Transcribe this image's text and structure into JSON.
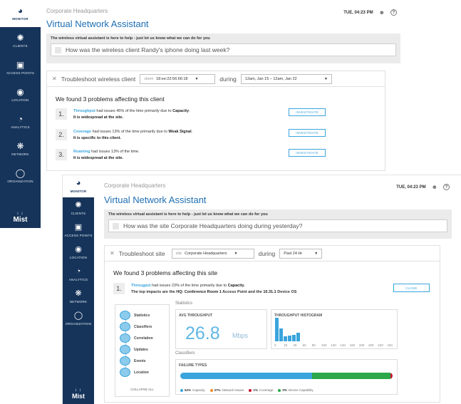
{
  "colors": {
    "sidebar": "#16345a",
    "accent": "#1e6fb4",
    "link": "#3aa4dd",
    "capacity": "#3aa4dd",
    "network_issues": "#f08a24",
    "coverage": "#c8102e",
    "device_capability": "#2aa84a"
  },
  "top": {
    "sidebar": [
      {
        "label": "MONITOR",
        "icon": "gauge-icon"
      },
      {
        "label": "CLIENTS",
        "icon": "clients-icon"
      },
      {
        "label": "ACCESS POINTS",
        "icon": "access-point-icon"
      },
      {
        "label": "LOCATION",
        "icon": "location-pin-icon"
      },
      {
        "label": "ANALYTICS",
        "icon": "pie-chart-icon"
      },
      {
        "label": "NETWORK",
        "icon": "network-icon"
      },
      {
        "label": "ORGANIZATION",
        "icon": "globe-icon"
      }
    ],
    "logo": "Mist",
    "site": "Corporate Headquarters",
    "title": "Virtual Network Assistant",
    "datetime": "TUE, 04:23 PM",
    "banner": "The wireless virtual assistant is here to help - just let us know what we can do for you",
    "question": "How was the wireless client Randy's iphone doing last week?",
    "troubleshoot_label": "Troubleshoot wireless client",
    "filter_prefix": "client",
    "filter_value": "18:ee:22:56:66:18",
    "during": "during",
    "range_value": "12am, Jan 15 – 12am, Jan 22",
    "found": "We found 3 problems affecting this client",
    "problems": [
      {
        "num": "1.",
        "metric": "Throughput",
        "mid": " had issues 45% of the time primarily due to ",
        "cause": "Capacity",
        "tail": ".",
        "line2": "It is widespread at the site.",
        "button": "INVESTIGATE"
      },
      {
        "num": "2.",
        "metric": "Coverage",
        "mid": " had issues 13% of the time primarily due to ",
        "cause": "Weak Signal",
        "tail": ".",
        "line2": "It is specific to this client.",
        "button": "INVESTIGATE"
      },
      {
        "num": "3.",
        "metric": "Roaming",
        "mid": " had issues 13% of the time.",
        "cause": "",
        "tail": "",
        "line2": "It is widespread at the site.",
        "button": "INVESTIGATE"
      }
    ]
  },
  "bottom": {
    "sidebar": [
      {
        "label": "MONITOR",
        "icon": "gauge-icon"
      },
      {
        "label": "CLIENTS",
        "icon": "clients-icon"
      },
      {
        "label": "ACCESS POINTS",
        "icon": "access-point-icon"
      },
      {
        "label": "LOCATION",
        "icon": "location-pin-icon"
      },
      {
        "label": "ANALYTICS",
        "icon": "pie-chart-icon"
      },
      {
        "label": "NETWORK",
        "icon": "network-icon"
      },
      {
        "label": "ORGANIZATION",
        "icon": "globe-icon"
      }
    ],
    "logo": "Mist",
    "site": "Corporate Headquarters",
    "title": "Virtual Network Assistant",
    "datetime": "TUE, 04:23 PM",
    "banner": "The wireless virtual assistant is here to help - just let us know what we can do for you",
    "question": "How was the site Corporate Headquarters doing during yesterday?",
    "troubleshoot_label": "Troubleshoot site",
    "filter_prefix": "site",
    "filter_value": "Corporate Headquarters",
    "during": "during",
    "range_value": "Past 24 Hr",
    "found": "We found 3 problems affecting this site",
    "problem": {
      "num": "1.",
      "metric": "Througput",
      "mid": " had issues 23% of the time primarily due to ",
      "cause": "Capacity",
      "tail": ".",
      "line2_pre": "The top impacts are the ",
      "line2_b1": "HQ: Conference Room 1",
      "line2_mid": " Access Point and the ",
      "line2_b2": "10.31.1",
      "line2_post": " Device OS",
      "button": "CLOSE"
    },
    "steps": [
      "Statistics",
      "Classifiers",
      "Correlation",
      "Updates",
      "Events",
      "Location"
    ],
    "collapse_all": "COLLAPSE ALL",
    "statistics_label": "Statistics",
    "avg_title": "AVG THROUGHPUT",
    "avg_value": "26.8",
    "avg_unit": "Mbps",
    "histogram": {
      "title": "THROUGHPUT HISTOGRAM",
      "ticks": [
        "0",
        "20",
        "40",
        "60",
        "80",
        "100",
        "120",
        "140",
        "160",
        "180",
        "200",
        "220",
        "240"
      ],
      "values": [
        1.0,
        0.55,
        0.22,
        0.25,
        0.28,
        0.35
      ]
    },
    "classifiers_label": "Classifiers",
    "failure_title": "FAILURE TYPES",
    "failure_types": [
      {
        "pct": "62%",
        "label": "Capacity",
        "value": 62,
        "color": "#3aa4dd"
      },
      {
        "pct": "37%",
        "label": "Network Issues",
        "value": 37,
        "color": "#2aa84a"
      },
      {
        "pct": "1%",
        "label": "Coverage",
        "value": 1,
        "color": "#c8102e"
      },
      {
        "pct": "0%",
        "label": "Device Capability",
        "value": 0,
        "color": "#2aa84a"
      }
    ],
    "legend": [
      {
        "pct": "62%",
        "label": "Capacity",
        "color": "#3aa4dd"
      },
      {
        "pct": "37%",
        "label": "Network Issues",
        "color": "#f08a24"
      },
      {
        "pct": "1%",
        "label": "Coverage",
        "color": "#c8102e"
      },
      {
        "pct": "0%",
        "label": "Device Capability",
        "color": "#2aa84a"
      }
    ]
  }
}
